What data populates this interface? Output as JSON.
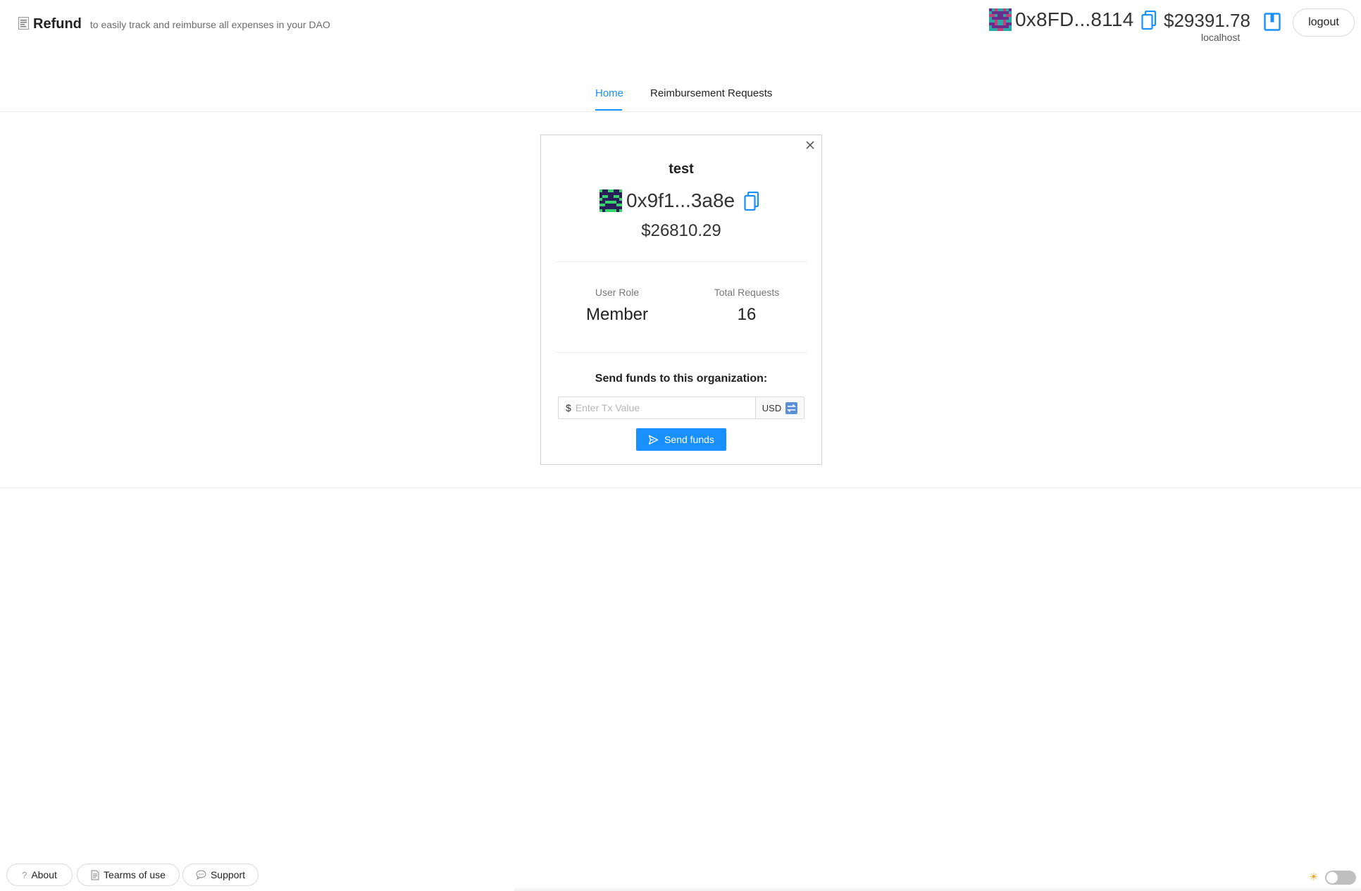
{
  "header": {
    "title": "Refund",
    "subtitle": "to easily track and reimburse all expenses in your DAO",
    "account": {
      "address": "0x8FD...8114",
      "balance": "$29391.78",
      "network": "localhost"
    },
    "logout_label": "logout"
  },
  "tabs": [
    {
      "label": "Home",
      "active": true
    },
    {
      "label": "Reimbursement Requests",
      "active": false
    }
  ],
  "organization": {
    "name": "test",
    "address": "0x9f1...3a8e",
    "balance": "$26810.29",
    "stats": {
      "role_label": "User Role",
      "role_value": "Member",
      "requests_label": "Total Requests",
      "requests_value": "16"
    },
    "send_title": "Send funds to this organization:",
    "tx_prefix": "$",
    "tx_placeholder": "Enter Tx Value",
    "currency": "USD",
    "send_label": "Send funds"
  },
  "footer": {
    "about_label": "About",
    "terms_label": "Tearms of use",
    "support_label": "Support"
  },
  "colors": {
    "accent": "#1890ff",
    "avatar_org_primary": "#2b1d5a",
    "avatar_org_secondary": "#35d46a",
    "avatar_acct_primary": "#6b2d8c",
    "avatar_acct_secondary": "#2aa8a8"
  },
  "icons": {
    "brand": "receipt-icon",
    "copy": "copy-icon",
    "wallet": "wallet-icon",
    "close": "close-icon",
    "swap": "swap-icon",
    "send": "send-icon",
    "about": "question-icon",
    "terms": "document-icon",
    "support": "chat-icon",
    "theme": "sun-icon"
  }
}
